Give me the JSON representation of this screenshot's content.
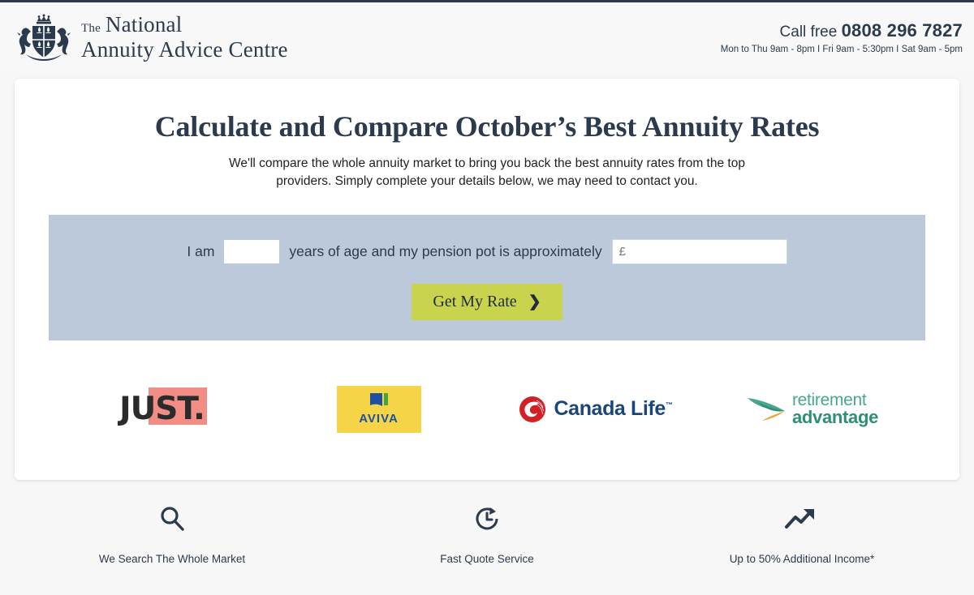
{
  "header": {
    "logo": {
      "crest_icon": "heraldic-shield-crest",
      "the": "The",
      "line1": "National",
      "line2": "Annuity Advice Centre"
    },
    "contact": {
      "call_label": "Call free",
      "phone": "0808 296 7827",
      "hours": "Mon to Thu 9am - 8pm I Fri 9am - 5:30pm I Sat 9am - 5pm"
    }
  },
  "main": {
    "headline": "Calculate and Compare October’s Best Annuity Rates",
    "subhead": "We'll compare the whole annuity market to bring you back the best annuity rates from the top providers. Simply complete your details below, we may need to contact you.",
    "form": {
      "prefix_label": "I am",
      "age_value": "",
      "age_placeholder": "",
      "middle_label": "years of age and my pension pot is approximately",
      "pot_value": "",
      "pot_placeholder": "£",
      "cta_label": "Get My Rate",
      "cta_chevron": "❯",
      "panel_color": "#bcc9da",
      "cta_color": "#c9d34e"
    }
  },
  "providers": [
    {
      "name": "JUST",
      "text": "JUST.",
      "accent": "#f28d85"
    },
    {
      "name": "Aviva",
      "text": "AVIVA",
      "accent": "#f5d547"
    },
    {
      "name": "Canada Life",
      "text": "Canada Life",
      "tm": "™",
      "accent": "#d32026"
    },
    {
      "name": "Retirement Advantage",
      "text_top": "retirement",
      "text_bottom": "advantage",
      "accent": "#2e8f76"
    }
  ],
  "features": [
    {
      "icon": "search-icon",
      "label": "We Search The Whole Market"
    },
    {
      "icon": "fast-clock-icon",
      "label": "Fast Quote Service"
    },
    {
      "icon": "trending-up-icon",
      "label": "Up to 50% Additional Income*"
    }
  ]
}
